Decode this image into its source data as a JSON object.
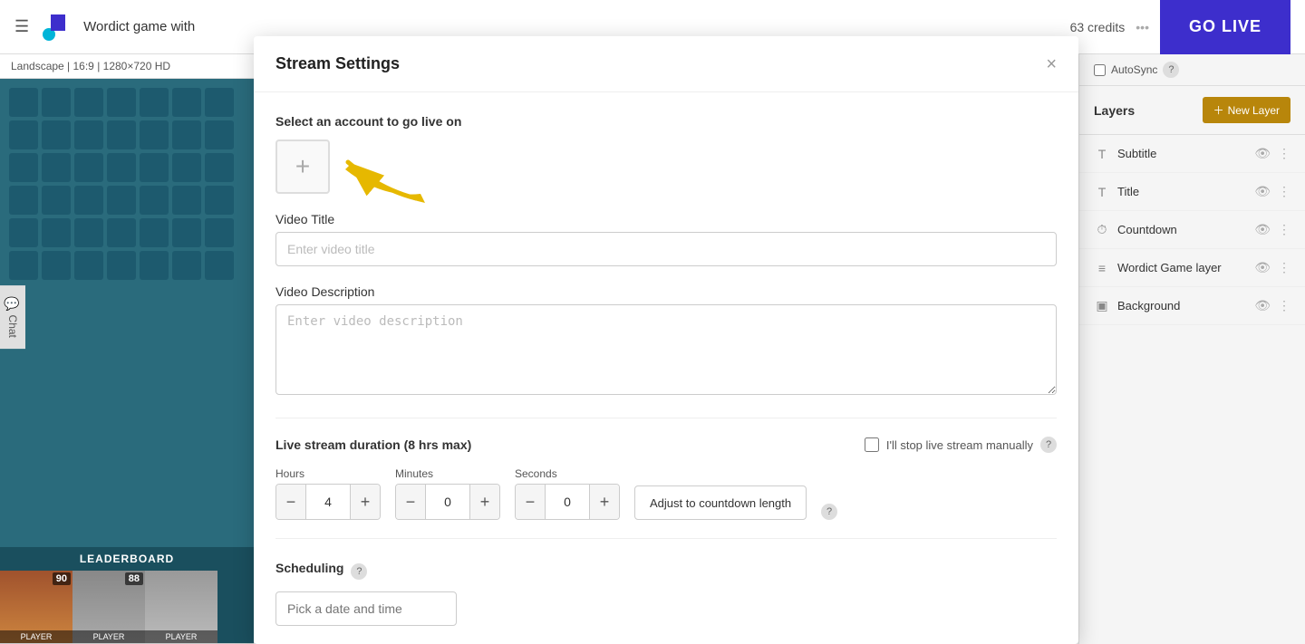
{
  "topbar": {
    "app_title": "Wordict game with",
    "credits": "63 credits",
    "go_live_label": "GO LIVE"
  },
  "canvas": {
    "label": "Landscape | 16:9 | 1280×720 HD",
    "leaderboard": "LEADERBOARD",
    "players": [
      {
        "score": "90",
        "label": "PLAYER"
      },
      {
        "score": "88",
        "label": "PLAYER"
      },
      {
        "score": "",
        "label": "PLAYER"
      }
    ]
  },
  "right_panel": {
    "autosync_label": "AutoSync",
    "layers_title": "Layers",
    "new_layer_label": "New Layer",
    "layers": [
      {
        "icon": "T",
        "name": "Subtitle"
      },
      {
        "icon": "T",
        "name": "Title"
      },
      {
        "icon": "⏱",
        "name": "Countdown"
      },
      {
        "icon": "≡",
        "name": "Wordict Game layer"
      },
      {
        "icon": "▣",
        "name": "Background"
      }
    ]
  },
  "chat": {
    "label": "Chat"
  },
  "modal": {
    "title": "Stream Settings",
    "close_label": "×",
    "select_account_label": "Select an account to go live on",
    "add_account_label": "+",
    "video_title_label": "Video Title",
    "video_title_placeholder": "Enter video title",
    "video_description_label": "Video Description",
    "video_description_placeholder": "Enter video description",
    "duration_label": "Live stream duration (8 hrs max)",
    "manual_stop_label": "I'll stop live stream manually",
    "hours_label": "Hours",
    "hours_value": "4",
    "minutes_label": "Minutes",
    "minutes_value": "0",
    "seconds_label": "Seconds",
    "seconds_value": "0",
    "countdown_btn_label": "Adjust to countdown length",
    "scheduling_label": "Scheduling",
    "date_placeholder": "Pick a date and time"
  }
}
